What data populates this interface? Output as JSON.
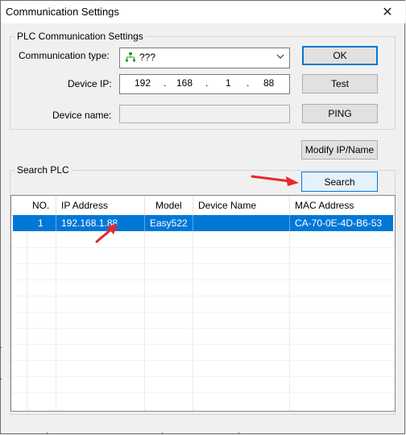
{
  "window": {
    "title": "Communication Settings",
    "close_glyph": "✕"
  },
  "plc_group": {
    "label": "PLC Communication Settings",
    "comm_type_label": "Communication type:",
    "comm_type_value": "???",
    "comm_type_icon": "network-icon",
    "device_ip_label": "Device IP:",
    "ip": [
      "192",
      "168",
      "1",
      "88"
    ],
    "device_name_label": "Device name:",
    "device_name_value": ""
  },
  "buttons": {
    "ok": "OK",
    "test": "Test",
    "ping": "PING",
    "modify": "Modify IP/Name",
    "search": "Search"
  },
  "search_group": {
    "label": "Search PLC"
  },
  "table": {
    "columns": [
      "NO.",
      "IP Address",
      "Model",
      "Device Name",
      "MAC Address"
    ],
    "rows": [
      {
        "no": "1",
        "ip": "192.168.1.88",
        "model": "Easy522",
        "name": "",
        "mac": "CA-70-0E-4D-B6-53",
        "selected": true
      }
    ]
  },
  "colors": {
    "selection": "#0078d7",
    "annotation_arrow": "#e8282b",
    "default_button_border": "#0078d7"
  }
}
